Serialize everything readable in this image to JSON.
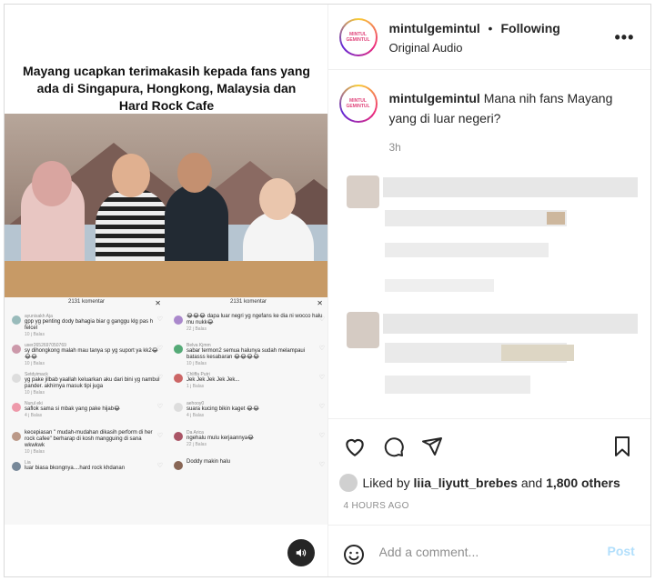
{
  "media": {
    "title": "Mayang ucapkan terimakasih kepada fans yang ada di Singapura, Hongkong, Malaysia dan Hard Rock Cafe",
    "comment_panels": [
      {
        "header": "2131 komentar",
        "items": [
          {
            "name": "ayunisakh Aja",
            "text": "gpp yg penting dody bahagia biar g ganggu klg pas h felcel",
            "meta": "10 j  Balas"
          },
          {
            "name": "user2652697050769",
            "text": "sy dihongkong malah mau tanya sp yg suport ya kk2😂😂😂",
            "meta": "10 j  Balas"
          },
          {
            "name": "Setdyimack",
            "text": "yg pake jilbab yaallah keluarkan aku dari bini yg nambul pander. akhirnya masuk tipi juga",
            "meta": "10 j  Balas"
          },
          {
            "name": "Nurul eki",
            "text": "saflok sama si mbak yang pake hijab😂",
            "meta": "4 j  Balas"
          },
          {
            "name": "",
            "text": "kecepiasan \" mudah-mudahan dikasih perform di her rock cafee\" berharap di kosh mangguing di sana wkwkwk",
            "meta": "10 j  Balas"
          },
          {
            "name": "Lia",
            "text": "luar biasa bkongnya....hard rock khdanan",
            "meta": ""
          }
        ]
      },
      {
        "header": "2131 komentar",
        "items": [
          {
            "name": "",
            "text": "😂😂😂 dapa luar negri yg ngefans ke dia ni wocco halu mu nukk😂",
            "meta": "22 j  Balas"
          },
          {
            "name": "Belva Kjmm",
            "text": "sabar termon2 semua halunya sudah melampaui batasss kesabaran 😂😂😂😂",
            "meta": "10 j  Balas"
          },
          {
            "name": "Chliffa Putri",
            "text": "Jek Jek Jek Jek Jek...",
            "meta": "1 j  Balas"
          },
          {
            "name": "aehooy0",
            "text": "suara kucing bikin kaget 😂😂",
            "meta": "4 j  Balas"
          },
          {
            "name": "Da Arica",
            "text": "ngehalu mulu kerjaannya😂",
            "meta": "22 j  Balas"
          },
          {
            "name": "",
            "text": "Doddy makin halu",
            "meta": ""
          }
        ]
      }
    ]
  },
  "header": {
    "username": "mintulgemintul",
    "separator": "•",
    "follow_state": "Following",
    "audio": "Original Audio",
    "avatar_text": "MINTUL GEMINTUL"
  },
  "caption": {
    "username": "mintulgemintul",
    "text": "Mana nih fans Mayang yang di luar negeri?",
    "time": "3h"
  },
  "likes": {
    "prefix": "Liked by",
    "user": "liia_liyutt_brebes",
    "joiner": "and",
    "others": "1,800 others"
  },
  "timestamp": "4 HOURS AGO",
  "comment_box": {
    "placeholder": "Add a comment...",
    "post_label": "Post"
  },
  "icons": [
    "heart-icon",
    "comment-icon",
    "share-icon",
    "bookmark-icon",
    "emoji-icon",
    "more-icon",
    "sound-icon"
  ],
  "colors": {
    "post_disabled": "#b2dffc",
    "muted": "#8e8e8e",
    "text": "#262626"
  }
}
